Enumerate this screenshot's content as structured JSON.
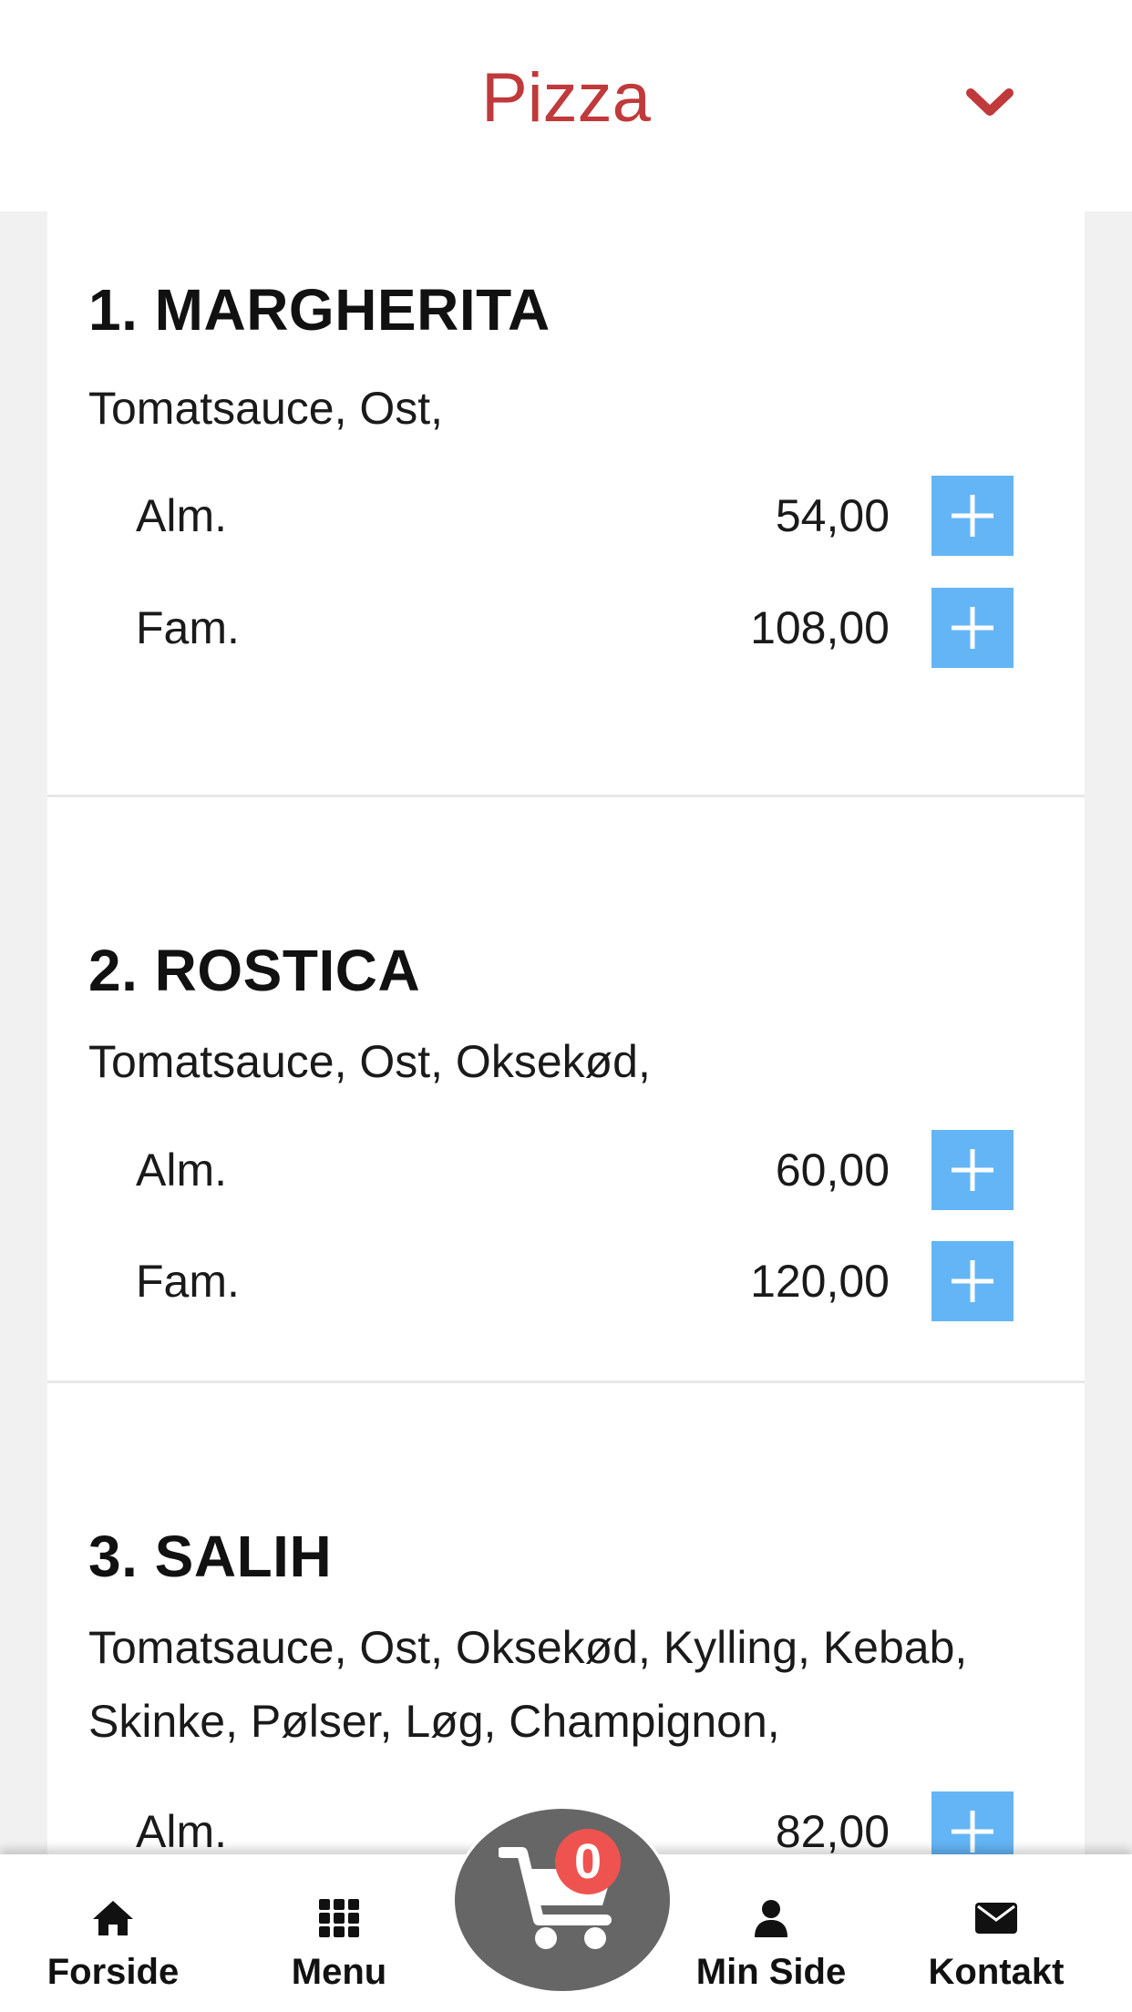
{
  "header": {
    "title": "Pizza",
    "chevron_icon": "chevron-down-icon"
  },
  "menu_items": [
    {
      "name": "1. MARGHERITA",
      "description": "Tomatsauce, Ost,",
      "prices": [
        {
          "size": "Alm.",
          "price": "54,00"
        },
        {
          "size": "Fam.",
          "price": "108,00"
        }
      ]
    },
    {
      "name": "2. ROSTICA",
      "description": "Tomatsauce, Ost, Oksekød,",
      "prices": [
        {
          "size": "Alm.",
          "price": "60,00"
        },
        {
          "size": "Fam.",
          "price": "120,00"
        }
      ]
    },
    {
      "name": "3. SALIH",
      "description": "Tomatsauce, Ost, Oksekød, Kylling, Kebab, Skinke, Pølser, Løg, Champignon,",
      "prices": [
        {
          "size": "Alm.",
          "price": "82,00"
        }
      ]
    }
  ],
  "bottom_nav": {
    "items": [
      {
        "label": "Forside",
        "icon": "home-icon"
      },
      {
        "label": "Menu",
        "icon": "grid-icon"
      },
      {
        "label": "Min Side",
        "icon": "user-icon"
      },
      {
        "label": "Kontakt",
        "icon": "envelope-icon"
      }
    ],
    "cart": {
      "count": "0",
      "icon": "cart-icon"
    }
  },
  "colors": {
    "title": "#c0393b",
    "add_button": "#64b5f6",
    "cart_bg": "#666666",
    "badge": "#ef5350"
  }
}
